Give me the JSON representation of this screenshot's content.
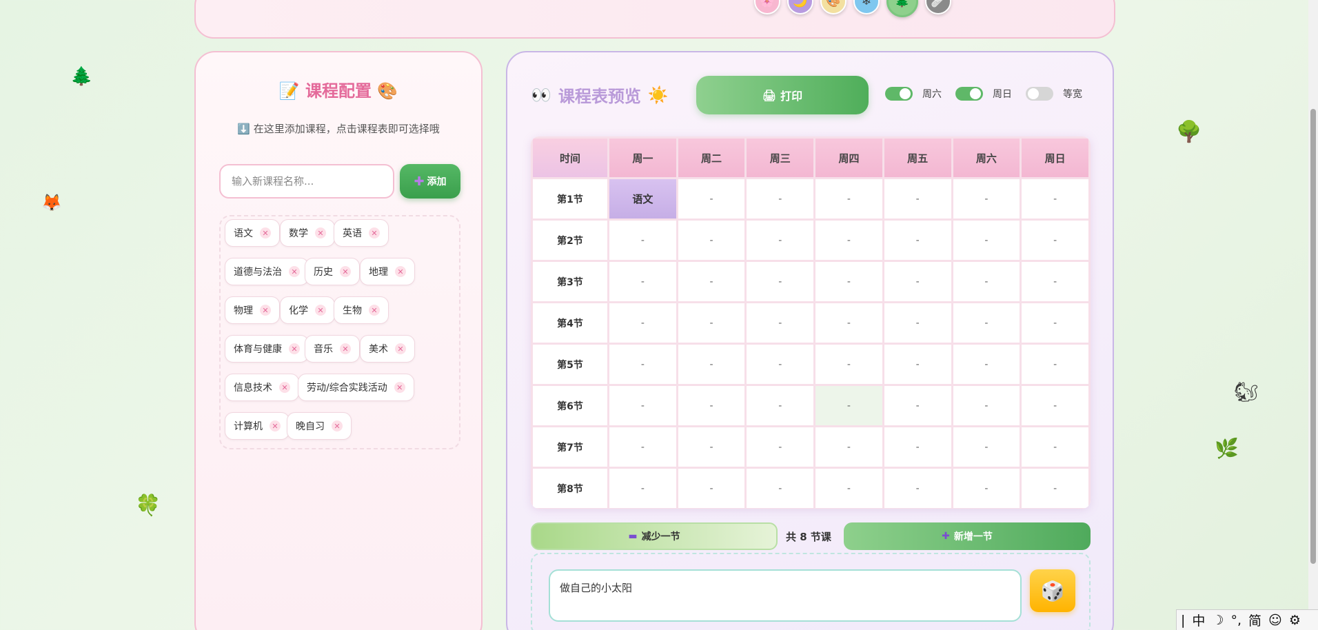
{
  "theme_icons": [
    "🌸",
    "🌙",
    "🎨",
    "❄",
    "🌲",
    "🩹"
  ],
  "decorations": [
    "🌲",
    "🦊",
    "🍀",
    "🌳",
    "🐿",
    "🌿"
  ],
  "config": {
    "title_icon_left": "📝",
    "title": "课程配置",
    "title_icon_right": "🎨",
    "hint_icon": "⬇️",
    "hint": "在这里添加课程，点击课程表即可选择哦",
    "input_placeholder": "输入新课程名称...",
    "add_icon": "✚",
    "add_label": "添加",
    "remove_icon": "✕",
    "courses": [
      "语文",
      "数学",
      "英语",
      "道德与法治",
      "历史",
      "地理",
      "物理",
      "化学",
      "生物",
      "体育与健康",
      "音乐",
      "美术",
      "信息技术",
      "劳动/综合实践活动",
      "计算机",
      "晚自习"
    ]
  },
  "preview": {
    "title_icon_left": "👀",
    "title": "课程表预览",
    "title_icon_right": "☀️",
    "print_icon": "🖨",
    "print_label": "打印",
    "toggles": [
      {
        "label": "周六",
        "on": true
      },
      {
        "label": "周日",
        "on": true
      },
      {
        "label": "等宽",
        "on": false
      }
    ]
  },
  "schedule": {
    "headers": [
      "时间",
      "周一",
      "周二",
      "周三",
      "周四",
      "周五",
      "周六",
      "周日"
    ],
    "rows": [
      {
        "period": "第1节",
        "cells": [
          "语文",
          "-",
          "-",
          "-",
          "-",
          "-",
          "-"
        ]
      },
      {
        "period": "第2节",
        "cells": [
          "-",
          "-",
          "-",
          "-",
          "-",
          "-",
          "-"
        ]
      },
      {
        "period": "第3节",
        "cells": [
          "-",
          "-",
          "-",
          "-",
          "-",
          "-",
          "-"
        ]
      },
      {
        "period": "第4节",
        "cells": [
          "-",
          "-",
          "-",
          "-",
          "-",
          "-",
          "-"
        ]
      },
      {
        "period": "第5节",
        "cells": [
          "-",
          "-",
          "-",
          "-",
          "-",
          "-",
          "-"
        ]
      },
      {
        "period": "第6节",
        "cells": [
          "-",
          "-",
          "-",
          "-",
          "-",
          "-",
          "-"
        ]
      },
      {
        "period": "第7节",
        "cells": [
          "-",
          "-",
          "-",
          "-",
          "-",
          "-",
          "-"
        ]
      },
      {
        "period": "第8节",
        "cells": [
          "-",
          "-",
          "-",
          "-",
          "-",
          "-",
          "-"
        ]
      }
    ]
  },
  "controls": {
    "minus_icon": "▬",
    "minus_label": "减少一节",
    "total_label": "共 8 节课",
    "plus_icon": "✚",
    "plus_label": "新增一节"
  },
  "motto": {
    "value": "做自己的小太阳",
    "dice_icon": "🎲"
  },
  "ime": [
    "|",
    "中",
    "☽",
    "°,",
    "简",
    "☺",
    "⚙"
  ]
}
